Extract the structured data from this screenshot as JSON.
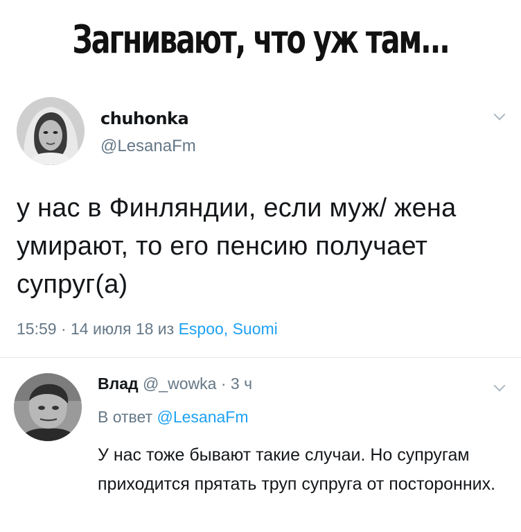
{
  "meme": {
    "title": "Загнивают, что уж там..."
  },
  "tweet": {
    "display_name": "chuhonka",
    "handle": "@LesanaFm",
    "text": "у нас в Финляндии, если муж/ жена умирают, то его пенсию получает супруг(а)",
    "timestamp": "15:59 · 14 июля 18 из ",
    "location": "Espoo, Suomi",
    "avatar_icon": "woman-portrait-avatar",
    "menu_icon": "chevron-down-icon"
  },
  "reply": {
    "display_name": "Влад",
    "handle": "@_wowka",
    "separator": "·",
    "time": "3 ч",
    "reply_prefix": "В ответ ",
    "reply_to": "@LesanaFm",
    "text": "У нас тоже бывают такие случаи. Но супругам приходится прятать труп супруга от посторонних.",
    "avatar_icon": "man-portrait-avatar",
    "menu_icon": "chevron-down-icon"
  },
  "colors": {
    "text": "#14171a",
    "secondary": "#657786",
    "link": "#1da1f2",
    "divider": "#e1e8ed"
  }
}
